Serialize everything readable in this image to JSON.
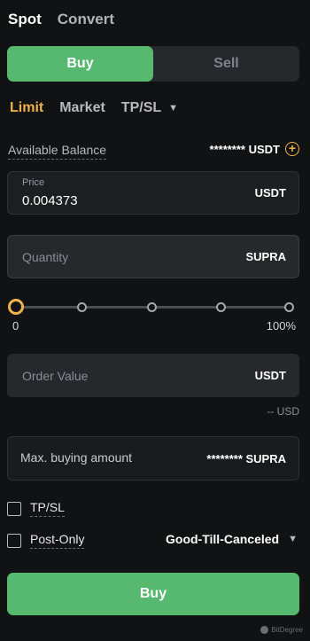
{
  "tabs": {
    "spot": "Spot",
    "convert": "Convert"
  },
  "side_toggle": {
    "buy": "Buy",
    "sell": "Sell"
  },
  "order_types": {
    "limit": "Limit",
    "market": "Market",
    "tpsl": "TP/SL"
  },
  "balance": {
    "label": "Available Balance",
    "value": "******** USDT"
  },
  "price": {
    "label": "Price",
    "value": "0.004373",
    "unit": "USDT"
  },
  "quantity": {
    "placeholder": "Quantity",
    "unit": "SUPRA"
  },
  "slider": {
    "min_label": "0",
    "max_label": "100%",
    "value_percent": 0
  },
  "order_value": {
    "placeholder": "Order Value",
    "unit": "USDT",
    "usd_estimate": "-- USD"
  },
  "max_buying": {
    "label": "Max. buying amount",
    "value": "******** SUPRA"
  },
  "options": {
    "tpsl": "TP/SL",
    "post_only": "Post-Only",
    "time_in_force": "Good-Till-Canceled"
  },
  "submit": {
    "label": "Buy"
  },
  "watermark": {
    "text": "BitDegree"
  },
  "colors": {
    "accent_green": "#56b96f",
    "accent_yellow": "#f0b34a",
    "background": "#111214"
  }
}
